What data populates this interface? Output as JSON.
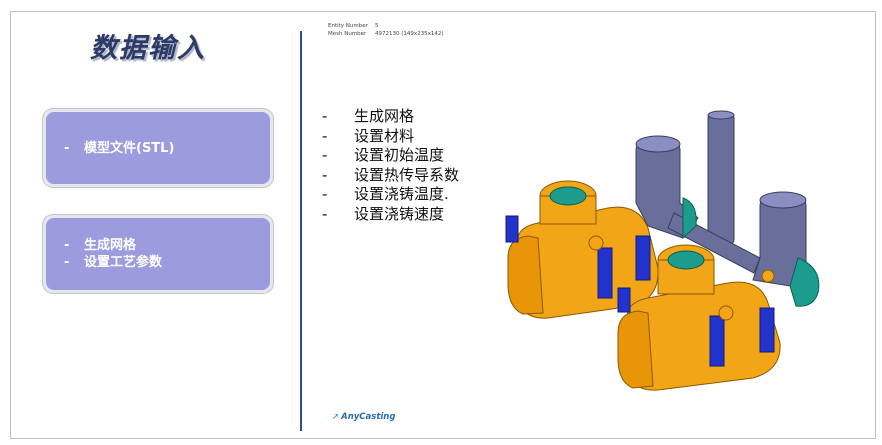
{
  "slide": {
    "title": "数据输入",
    "box1": {
      "items": [
        "模型文件(STL)"
      ]
    },
    "box2": {
      "items": [
        "生成网格",
        "设置工艺参数"
      ]
    },
    "meta": [
      {
        "key": "Entity Number",
        "value": "5"
      },
      {
        "key": "Mesh Number",
        "value": "4972130 (149x235x142)"
      }
    ],
    "steps": [
      "生成网格",
      "设置材料",
      "设置初始温度",
      "设置热传导系数",
      "设置浇铸温度.",
      "设置浇铸速度"
    ],
    "dash": "-",
    "logo": "AnyCasting"
  },
  "colors": {
    "accent_box": "#9b9bde",
    "divider": "#2c4e8a",
    "casting": "#f2a516",
    "mold_gray": "#6a6e9a",
    "teal": "#1c9c8c",
    "blue": "#2233cc"
  }
}
